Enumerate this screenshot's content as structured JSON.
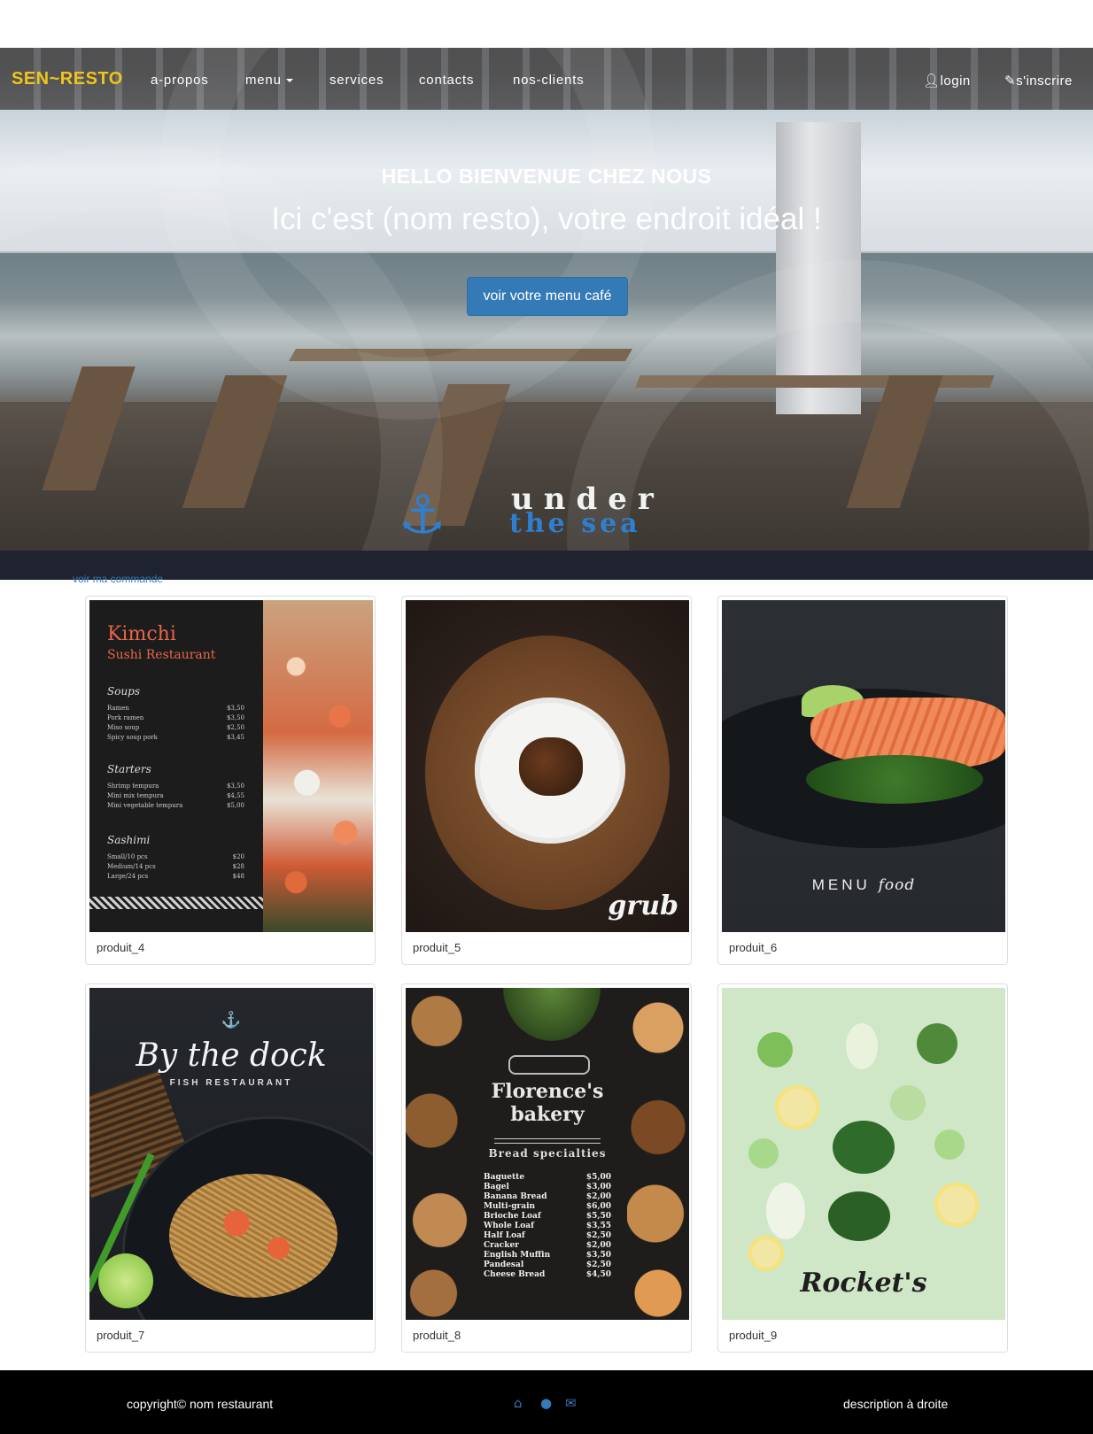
{
  "navbar": {
    "brand": "SEN~RESTO",
    "links": [
      "a-propos",
      "menu",
      "services",
      "contacts",
      "nos-clients"
    ],
    "login": "login",
    "signup": "s'inscrire",
    "login_icon": "user-icon",
    "signup_icon": "pencil-icon"
  },
  "hero": {
    "title": "HELLO BIENVENUE CHEZ NOUS",
    "subtitle": "Ici c'est (nom resto), votre endroit idéal !",
    "button_label": "voir votre menu café",
    "logo_line1": "under",
    "logo_line2": "the sea",
    "logo_icon": "anchor-icon"
  },
  "order_link": "voir ma commande",
  "products": [
    {
      "caption": "produit_4"
    },
    {
      "caption": "produit_5"
    },
    {
      "caption": "produit_6"
    },
    {
      "caption": "produit_7"
    },
    {
      "caption": "produit_8"
    },
    {
      "caption": "produit_9"
    }
  ],
  "images": {
    "kimchi": {
      "name": "Kimchi",
      "sub": "Sushi Restaurant",
      "sections": [
        {
          "title": "Soups",
          "items": [
            [
              "Ramen",
              "$3,50"
            ],
            [
              "Pork ramen",
              "$3,50"
            ],
            [
              "Miso soup",
              "$2,50"
            ],
            [
              "Spicy soup pork",
              "$3,45"
            ]
          ]
        },
        {
          "title": "Starters",
          "items": [
            [
              "Shrimp tempura",
              "$3,50"
            ],
            [
              "Mini mix tempura",
              "$4,55"
            ],
            [
              "Mini vegetable tempura",
              "$5,00"
            ]
          ]
        },
        {
          "title": "Sashimi",
          "items": [
            [
              "Small/10 pcs",
              "$20"
            ],
            [
              "Medium/14 pcs",
              "$28"
            ],
            [
              "Large/24 pcs",
              "$48"
            ]
          ]
        }
      ]
    },
    "grub": "grub",
    "menu_food": {
      "menu": "MENU",
      "food": "food"
    },
    "dock": {
      "title": "By the dock",
      "sub": "FISH RESTAURANT"
    },
    "bakery": {
      "title_line1": "Florence's",
      "title_line2": "bakery",
      "specialties": "Bread specialties",
      "items": [
        [
          "Baguette",
          "$5,00"
        ],
        [
          "Bagel",
          "$3,00"
        ],
        [
          "Banana Bread",
          "$2,00"
        ],
        [
          "Multi-grain",
          "$6,00"
        ],
        [
          "Brioche Loaf",
          "$5,50"
        ],
        [
          "Whole Loaf",
          "$3,55"
        ],
        [
          "Half Loaf",
          "$2,50"
        ],
        [
          "Cracker",
          "$2,00"
        ],
        [
          "English Muffin",
          "$3,50"
        ],
        [
          "Pandesal",
          "$2,50"
        ],
        [
          "Cheese Bread",
          "$4,50"
        ]
      ]
    },
    "rocket": "Rocket's"
  },
  "footer": {
    "copyright": "copyright© nom restaurant",
    "description": "description à droite",
    "icons": [
      "home-icon",
      "user-icon",
      "envelope-icon"
    ]
  },
  "colors": {
    "brand": "#f0c419",
    "primary": "#337ab7",
    "footer_bg": "#000000"
  }
}
